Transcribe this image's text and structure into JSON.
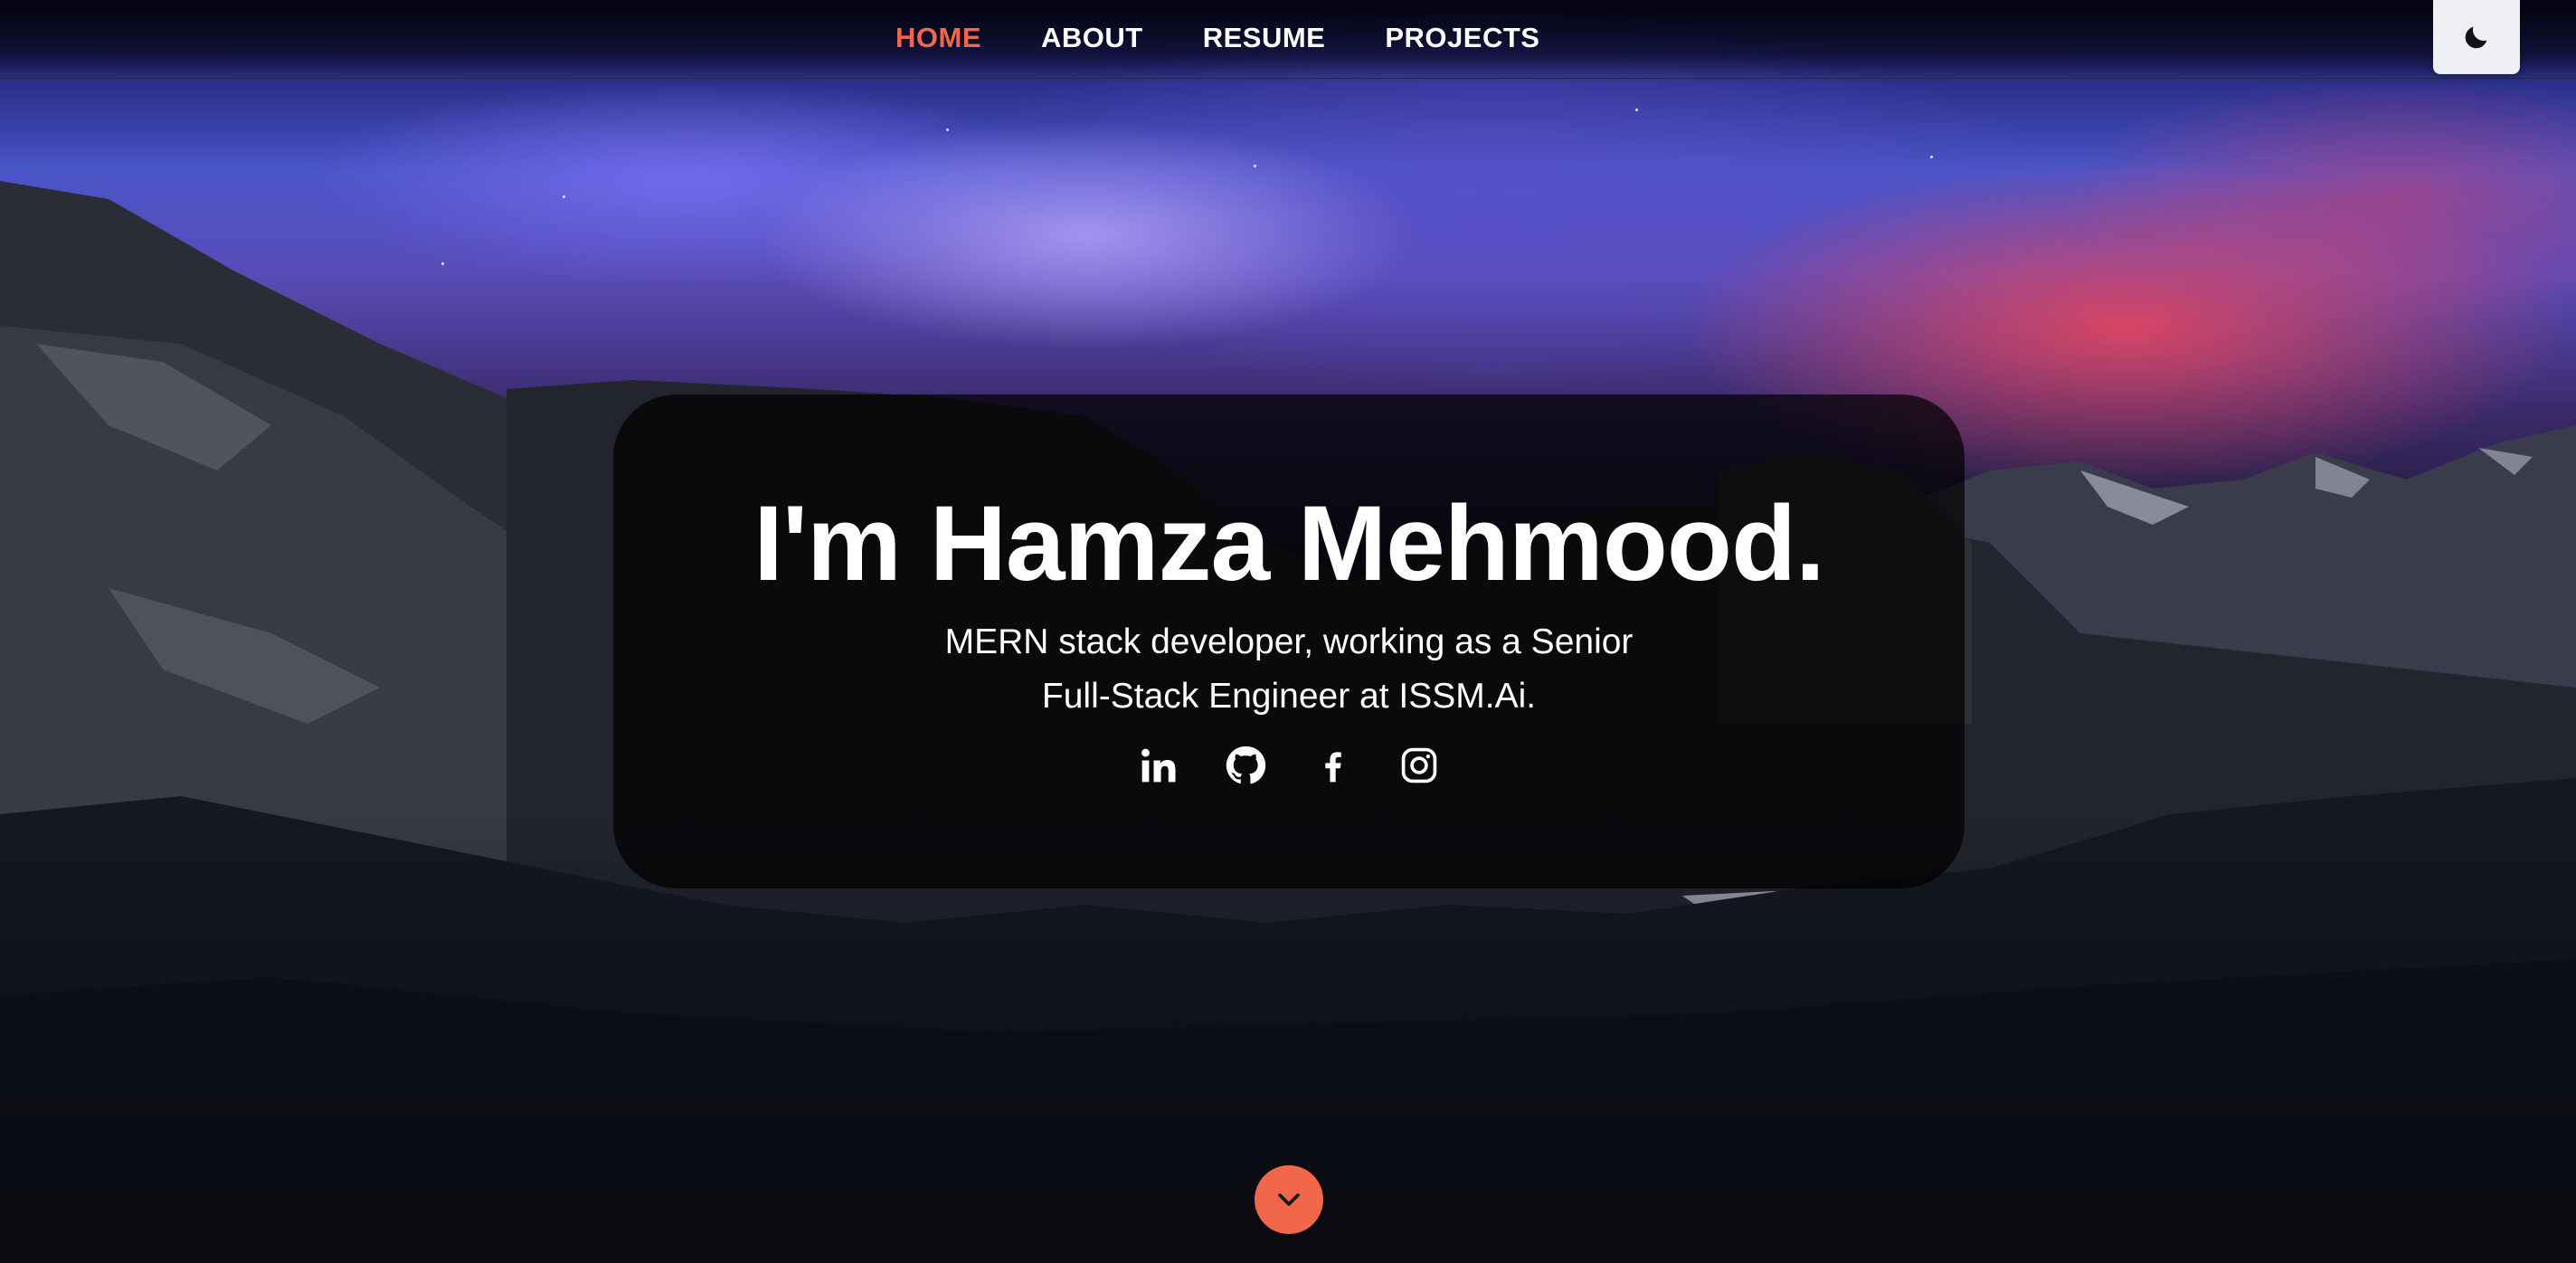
{
  "nav": {
    "items": [
      {
        "label": "HOME",
        "active": true
      },
      {
        "label": "ABOUT",
        "active": false
      },
      {
        "label": "RESUME",
        "active": false
      },
      {
        "label": "PROJECTS",
        "active": false
      }
    ],
    "theme_toggle_icon": "moon-icon"
  },
  "hero": {
    "title": "I'm Hamza Mehmood.",
    "subtitle_line1": "MERN stack developer, working as a Senior",
    "subtitle_line2": "Full-Stack Engineer at ISSM.Ai.",
    "socials": [
      {
        "icon": "linkedin-icon"
      },
      {
        "icon": "github-icon"
      },
      {
        "icon": "facebook-icon"
      },
      {
        "icon": "instagram-icon"
      }
    ]
  },
  "scroll_button": {
    "icon": "chevron-down-icon"
  },
  "colors": {
    "accent": "#f2674a",
    "card_background": "rgba(0,0,0,0.7)",
    "toggle_background": "#eef0f4",
    "text": "#ffffff"
  }
}
